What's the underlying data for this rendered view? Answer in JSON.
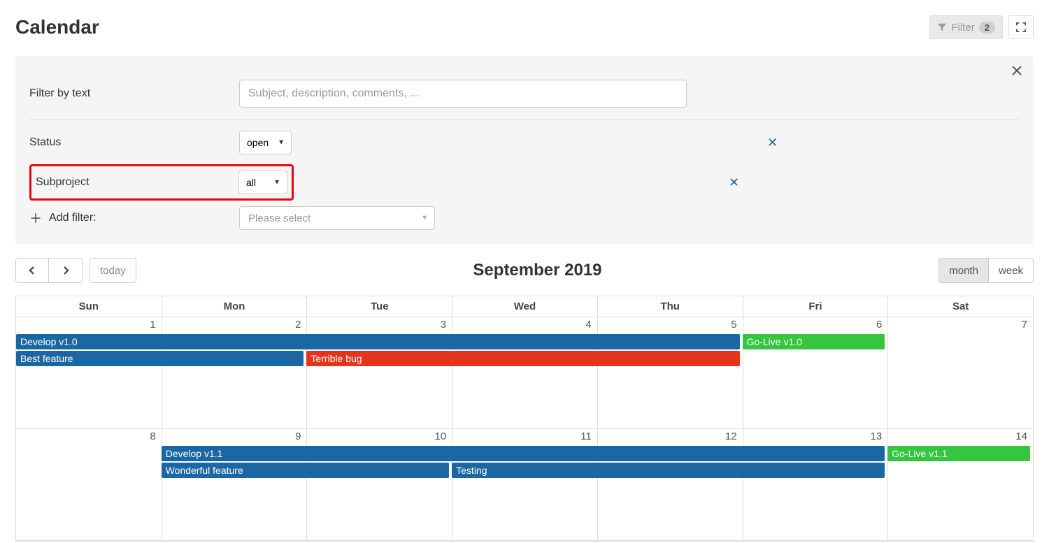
{
  "page_title": "Calendar",
  "header": {
    "filter_label": "Filter",
    "filter_count": "2"
  },
  "filters": {
    "text_label": "Filter by text",
    "text_placeholder": "Subject, description, comments, ...",
    "status_label": "Status",
    "status_value": "open",
    "subproject_label": "Subproject",
    "subproject_value": "all",
    "add_filter_label": "Add filter:",
    "add_filter_placeholder": "Please select"
  },
  "nav": {
    "today_label": "today",
    "month_title": "September 2019",
    "view_month": "month",
    "view_week": "week"
  },
  "day_headers": [
    "Sun",
    "Mon",
    "Tue",
    "Wed",
    "Thu",
    "Fri",
    "Sat"
  ],
  "week1_days": [
    "1",
    "2",
    "3",
    "4",
    "5",
    "6",
    "7"
  ],
  "week2_days": [
    "8",
    "9",
    "10",
    "11",
    "12",
    "13",
    "14"
  ],
  "colors": {
    "blue": "#1a67a3",
    "green": "#35c53f",
    "red": "#e6341a"
  },
  "events_week1": [
    {
      "label": "Develop v1.0",
      "row": 0,
      "start": 0,
      "span": 5,
      "color": "blue"
    },
    {
      "label": "Go-Live v1.0",
      "row": 0,
      "start": 5,
      "span": 1,
      "color": "green"
    },
    {
      "label": "Best feature",
      "row": 1,
      "start": 0,
      "span": 2,
      "color": "blue"
    },
    {
      "label": "Terrible bug",
      "row": 1,
      "start": 2,
      "span": 3,
      "color": "red"
    }
  ],
  "events_week2": [
    {
      "label": "Develop v1.1",
      "row": 0,
      "start": 1,
      "span": 5,
      "color": "blue"
    },
    {
      "label": "Go-Live v1.1",
      "row": 0,
      "start": 6,
      "span": 1,
      "color": "green"
    },
    {
      "label": "Wonderful feature",
      "row": 1,
      "start": 1,
      "span": 2,
      "color": "blue"
    },
    {
      "label": "Testing",
      "row": 1,
      "start": 3,
      "span": 3,
      "color": "blue"
    }
  ]
}
